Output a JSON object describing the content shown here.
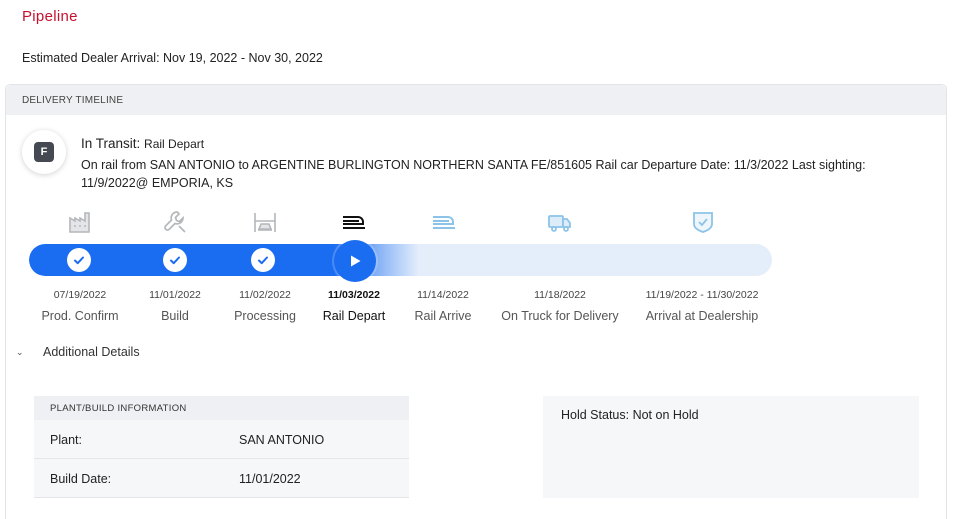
{
  "page": {
    "title": "Pipeline",
    "arrival": "Estimated Dealer Arrival: Nov 19, 2022 - Nov 30, 2022"
  },
  "timeline": {
    "header": "DELIVERY TIMELINE",
    "avatar_letter": "F",
    "status_label": "In Transit:",
    "status_value": "Rail Depart",
    "description": "On rail from SAN ANTONIO to ARGENTINE BURLINGTON NORTHERN SANTA FE/851605 Rail car Departure Date: 11/3/2022 Last sighting: 11/9/2022@ EMPORIA, KS",
    "progress_stage": 4,
    "stages": [
      {
        "label": "Prod. Confirm",
        "date": "07/19/2022",
        "icon": "factory-icon",
        "state": "complete"
      },
      {
        "label": "Build",
        "date": "11/01/2022",
        "icon": "wrench-icon",
        "state": "complete"
      },
      {
        "label": "Processing",
        "date": "11/02/2022",
        "icon": "car-lift-icon",
        "state": "complete"
      },
      {
        "label": "Rail Depart",
        "date": "11/03/2022",
        "icon": "train-icon",
        "state": "current"
      },
      {
        "label": "Rail Arrive",
        "date": "11/14/2022",
        "icon": "train-icon",
        "state": "upcoming"
      },
      {
        "label": "On Truck for Delivery",
        "date": "11/18/2022",
        "icon": "truck-icon",
        "state": "upcoming"
      },
      {
        "label": "Arrival at Dealership",
        "date": "11/19/2022 - 11/30/2022",
        "icon": "shield-check-icon",
        "state": "upcoming"
      }
    ]
  },
  "details": {
    "toggle_label": "Additional Details",
    "plant_header": "PLANT/BUILD INFORMATION",
    "rows": [
      {
        "key": "Plant:",
        "value": "SAN ANTONIO"
      },
      {
        "key": "Build Date:",
        "value": "11/01/2022"
      }
    ],
    "hold_status": "Hold Status: Not on Hold"
  },
  "colors": {
    "accent": "#1a6cf0",
    "brand_red": "#c8102e",
    "track_bg": "#e4eefb",
    "upcoming_icon": "#8cc3e8"
  }
}
